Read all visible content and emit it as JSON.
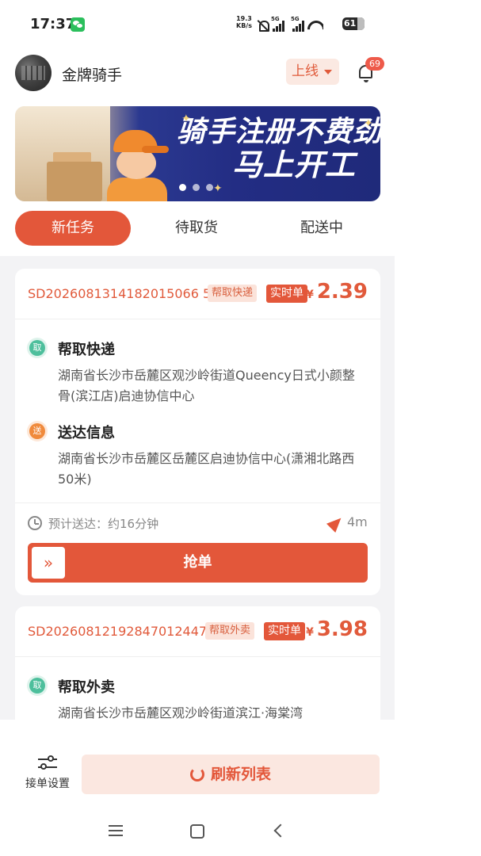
{
  "status_bar": {
    "time": "17:37",
    "net_speed_value": "19.3",
    "net_speed_unit": "KB/s",
    "signal1_label": "5G",
    "signal2_label": "5G",
    "battery": "61"
  },
  "header": {
    "rider_name": "金牌骑手",
    "online_label": "上线",
    "notification_count": "69"
  },
  "banner": {
    "headline_line1": "骑手注册不费劲",
    "headline_line2": "马上开工",
    "slides": 3,
    "active_slide": 1
  },
  "tabs": [
    {
      "label": "新任务",
      "active": true
    },
    {
      "label": "待取货",
      "active": false
    },
    {
      "label": "配送中",
      "active": false
    }
  ],
  "orders": [
    {
      "order_no": "SD20260813141820150665​7",
      "order_no_display": "SD2026081314182015066 57",
      "type_tag": "帮取快递",
      "realtime_tag": "实时单",
      "currency": "¥",
      "price": "2.39",
      "pickup": {
        "badge": "取",
        "title": "帮取快递",
        "address": "湖南省长沙市岳麓区观沙岭街道Queency日式小颜整骨(滨江店)启迪协信中心"
      },
      "dropoff": {
        "badge": "送",
        "title": "送达信息",
        "address": "湖南省长沙市岳麓区岳麓区启迪协信中心(潇湘北路西50米)"
      },
      "eta_label": "预计送达：约16分钟",
      "distance": "4m",
      "grab_label": "抢单",
      "grab_handle": "»"
    },
    {
      "order_no_display": "SD20260812192847012447 1",
      "type_tag": "帮取外卖",
      "realtime_tag": "实时单",
      "currency": "¥",
      "price": "3.98",
      "pickup": {
        "badge": "取",
        "title": "帮取外卖",
        "address": "湖南省长沙市岳麓区观沙岭街道滨江·海棠湾"
      }
    }
  ],
  "bottom_bar": {
    "settings_label": "接单设置",
    "refresh_label": "刷新列表"
  },
  "colors": {
    "accent": "#e3573a",
    "accent_light": "#fbe7e0",
    "pickup_green": "#4dbf9c",
    "dropoff_orange": "#f08a3c",
    "list_bg": "#f3f3f5"
  }
}
